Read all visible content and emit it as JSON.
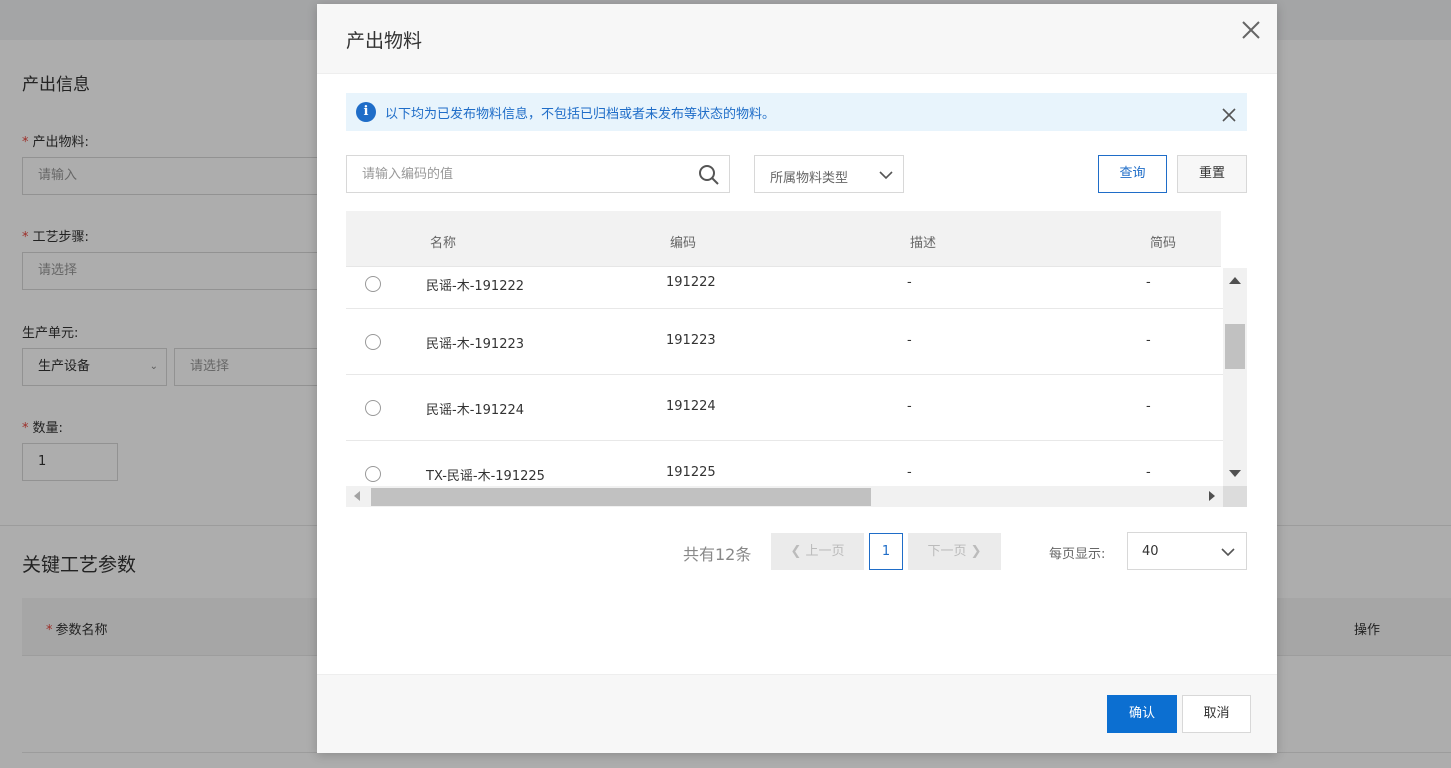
{
  "background": {
    "section_title": "产出信息",
    "fields": {
      "material_label": "产出物料:",
      "material_placeholder": "请输入",
      "step_label": "工艺步骤:",
      "step_placeholder": "请选择",
      "unit_label": "生产单元:",
      "unit_type_value": "生产设备",
      "unit_placeholder": "请选择",
      "quantity_label": "数量:",
      "quantity_value": "1"
    },
    "params_title": "关键工艺参数",
    "params_table": {
      "col_name": "参数名称",
      "col_action": "操作"
    }
  },
  "modal": {
    "title": "产出物料",
    "notice": "以下均为已发布物料信息，不包括已归档或者未发布等状态的物料。",
    "search": {
      "placeholder": "请输入编码的值"
    },
    "type_select": {
      "value": "所属物料类型"
    },
    "query_label": "查询",
    "reset_label": "重置",
    "table": {
      "columns": [
        "名称",
        "编码",
        "描述",
        "简码"
      ],
      "rows": [
        {
          "name": "民谣-木-191222",
          "code": "191222",
          "desc": "-",
          "short": "-"
        },
        {
          "name": "民谣-木-191223",
          "code": "191223",
          "desc": "-",
          "short": "-"
        },
        {
          "name": "民谣-木-191224",
          "code": "191224",
          "desc": "-",
          "short": "-"
        },
        {
          "name": "TX-民谣-木-191225",
          "code": "191225",
          "desc": "-",
          "short": "-"
        }
      ]
    },
    "pagination": {
      "total": "共有12条",
      "prev": "上一页",
      "current": "1",
      "next": "下一页",
      "per_page_label": "每页显示:",
      "per_page_value": "40"
    },
    "confirm_label": "确认",
    "cancel_label": "取消"
  },
  "colors": {
    "primary": "#0c6fd1",
    "notice_bg": "#e8f4fc",
    "required": "#e8453c"
  }
}
